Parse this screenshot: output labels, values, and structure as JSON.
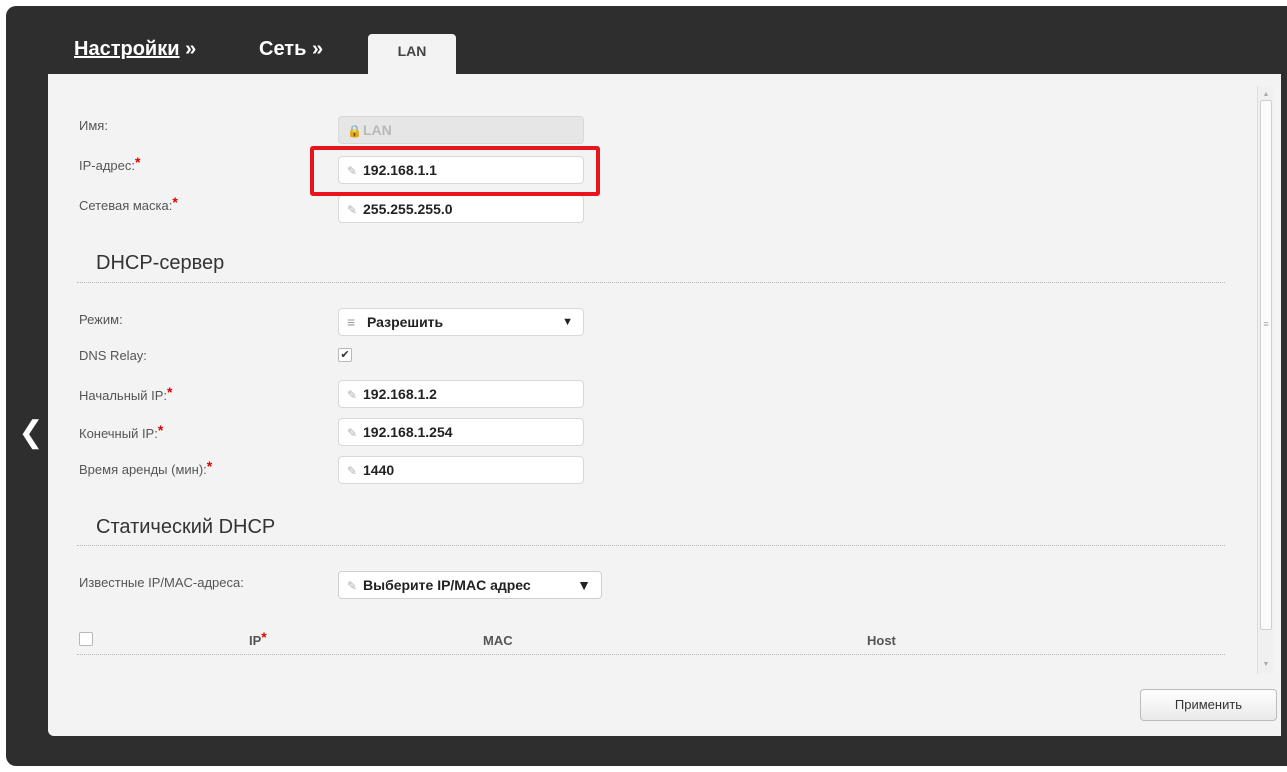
{
  "breadcrumb": {
    "settings": "Настройки",
    "separator1": "»",
    "network": "Сеть",
    "separator2": "»",
    "active_tab": "LAN"
  },
  "form": {
    "name_label": "Имя:",
    "name_value": "LAN",
    "ip_label": "IP-адрес:",
    "ip_value": "192.168.1.1",
    "mask_label": "Сетевая маска:",
    "mask_value": "255.255.255.0",
    "required_mark": "*"
  },
  "dhcp": {
    "title": "DHCP-сервер",
    "mode_label": "Режим:",
    "mode_value": "Разрешить",
    "dns_relay_label": "DNS Relay:",
    "dns_relay_checked": true,
    "start_ip_label": "Начальный IP:",
    "start_ip_value": "192.168.1.2",
    "end_ip_label": "Конечный IP:",
    "end_ip_value": "192.168.1.254",
    "lease_label": "Время аренды (мин):",
    "lease_value": "1440"
  },
  "static_dhcp": {
    "title": "Статический DHCP",
    "known_label": "Известные IP/MAC-адреса:",
    "known_placeholder": "Выберите IP/MAC адрес",
    "columns": [
      "IP",
      "MAC",
      "Host"
    ]
  },
  "actions": {
    "apply": "Применить"
  },
  "colors": {
    "highlight": "#e8141c",
    "required": "#e00000",
    "frame": "#2e2e2e"
  },
  "icons": {
    "back": "chevron-left-icon",
    "edit": "pencil-icon",
    "lock": "lock-icon",
    "list": "list-icon",
    "dropdown": "triangle-down-icon"
  }
}
